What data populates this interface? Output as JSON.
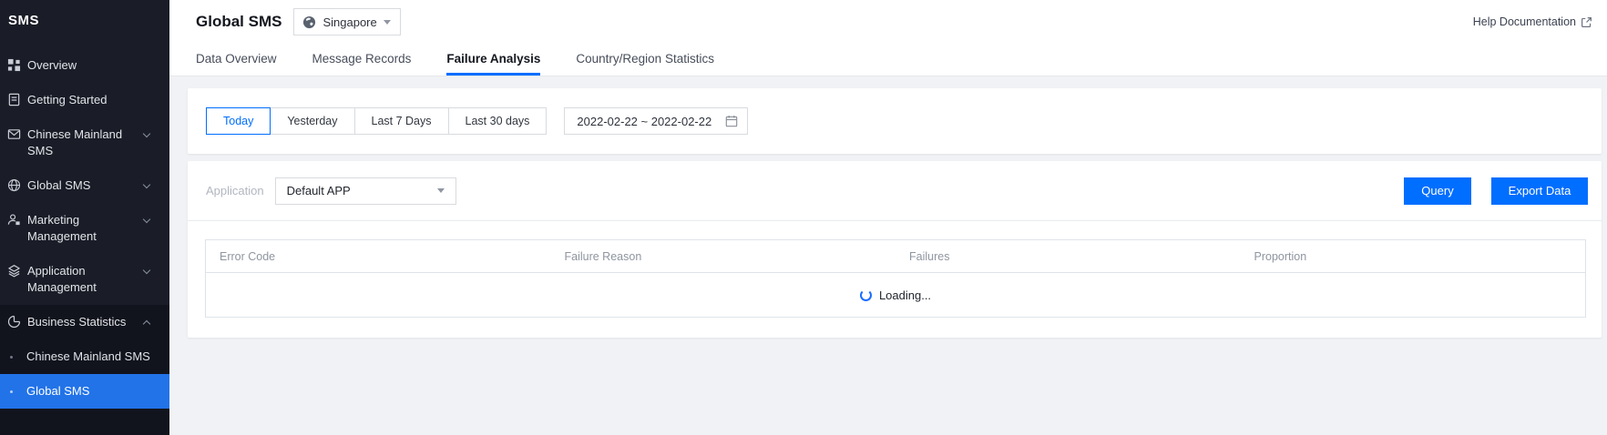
{
  "sidebar": {
    "logo": "SMS",
    "items": [
      {
        "label": "Overview",
        "icon": "grid-icon"
      },
      {
        "label": "Getting Started",
        "icon": "document-icon"
      },
      {
        "label": "Chinese Mainland SMS",
        "icon": "mail-icon",
        "chevron": "down"
      },
      {
        "label": "Global SMS",
        "icon": "globe-icon",
        "chevron": "down"
      },
      {
        "label": "Marketing Management",
        "icon": "person-icon",
        "chevron": "down"
      },
      {
        "label": "Application Management",
        "icon": "layers-icon",
        "chevron": "down"
      },
      {
        "label": "Business Statistics",
        "icon": "pie-chart-icon",
        "chevron": "up",
        "expanded": true,
        "children": [
          {
            "label": "Chinese Mainland SMS",
            "selected": false
          },
          {
            "label": "Global SMS",
            "selected": true
          }
        ]
      }
    ]
  },
  "header": {
    "title": "Global SMS",
    "region": {
      "label": "Singapore",
      "icon": "globe-icon"
    },
    "help_link": "Help Documentation",
    "tabs": [
      {
        "label": "Data Overview",
        "active": false
      },
      {
        "label": "Message Records",
        "active": false
      },
      {
        "label": "Failure Analysis",
        "active": true
      },
      {
        "label": "Country/Region Statistics",
        "active": false
      }
    ]
  },
  "filters": {
    "ranges": [
      "Today",
      "Yesterday",
      "Last 7 Days",
      "Last 30 days"
    ],
    "active_range": "Today",
    "date_range": "2022-02-22 ~ 2022-02-22"
  },
  "query_bar": {
    "application_label": "Application",
    "application_value": "Default APP",
    "query_button": "Query",
    "export_button": "Export Data"
  },
  "table": {
    "columns": [
      "Error Code",
      "Failure Reason",
      "Failures",
      "Proportion"
    ],
    "rows": [],
    "loading_text": "Loading..."
  },
  "colors": {
    "primary": "#006eff",
    "sidebar_bg": "#1a1d27",
    "sidebar_section_bg": "#12141d",
    "sidebar_selected": "#2273e8",
    "content_bg": "#f1f2f5",
    "input_border": "#d8dbdf",
    "table_border": "#dfe3e9",
    "muted_text": "#8f95a0"
  }
}
